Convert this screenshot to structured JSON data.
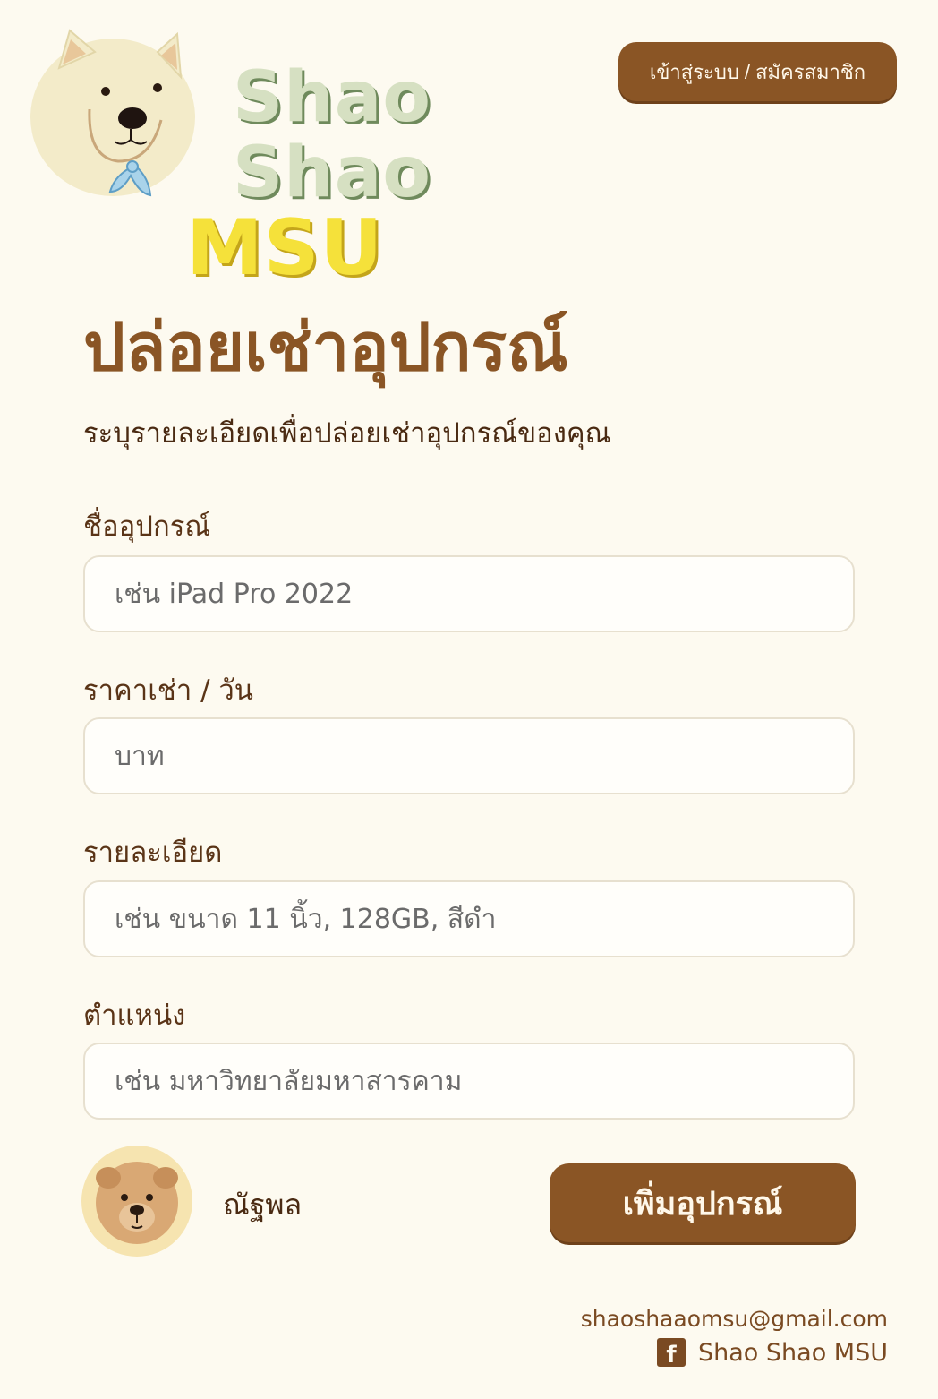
{
  "brand": {
    "line1": "Shao",
    "line2": "Shao",
    "line3": "MSU"
  },
  "header": {
    "login_label": "เข้าสู่ระบบ / สมัครสมาชิก"
  },
  "page": {
    "title": "ปล่อยเช่าอุปกรณ์",
    "subtitle": "ระบุรายละเอียดเพื่อปล่อยเช่าอุปกรณ์ของคุณ"
  },
  "form": {
    "fields": [
      {
        "label": "ชื่ออุปกรณ์",
        "placeholder": "เช่น iPad Pro 2022",
        "value": ""
      },
      {
        "label": "ราคาเช่า / วัน",
        "placeholder": "บาท",
        "value": ""
      },
      {
        "label": "รายละเอียด",
        "placeholder": "เช่น ขนาด 11 นิ้ว, 128GB, สีดำ",
        "value": ""
      },
      {
        "label": "ตำแหน่ง",
        "placeholder": "เช่น มหาวิทยาลัยมหาสารคาม",
        "value": ""
      }
    ],
    "submit_label": "เพิ่มอุปกรณ์"
  },
  "user": {
    "name": "ณัฐพล"
  },
  "footer": {
    "email": "shaoshaaomsu@gmail.com",
    "facebook_label": "Shao Shao MSU",
    "facebook_icon": "facebook-icon"
  },
  "colors": {
    "background": "#fdfaf0",
    "accent": "#8a5525",
    "logo_green": "#d6e0c2",
    "logo_yellow": "#f5e13a"
  }
}
